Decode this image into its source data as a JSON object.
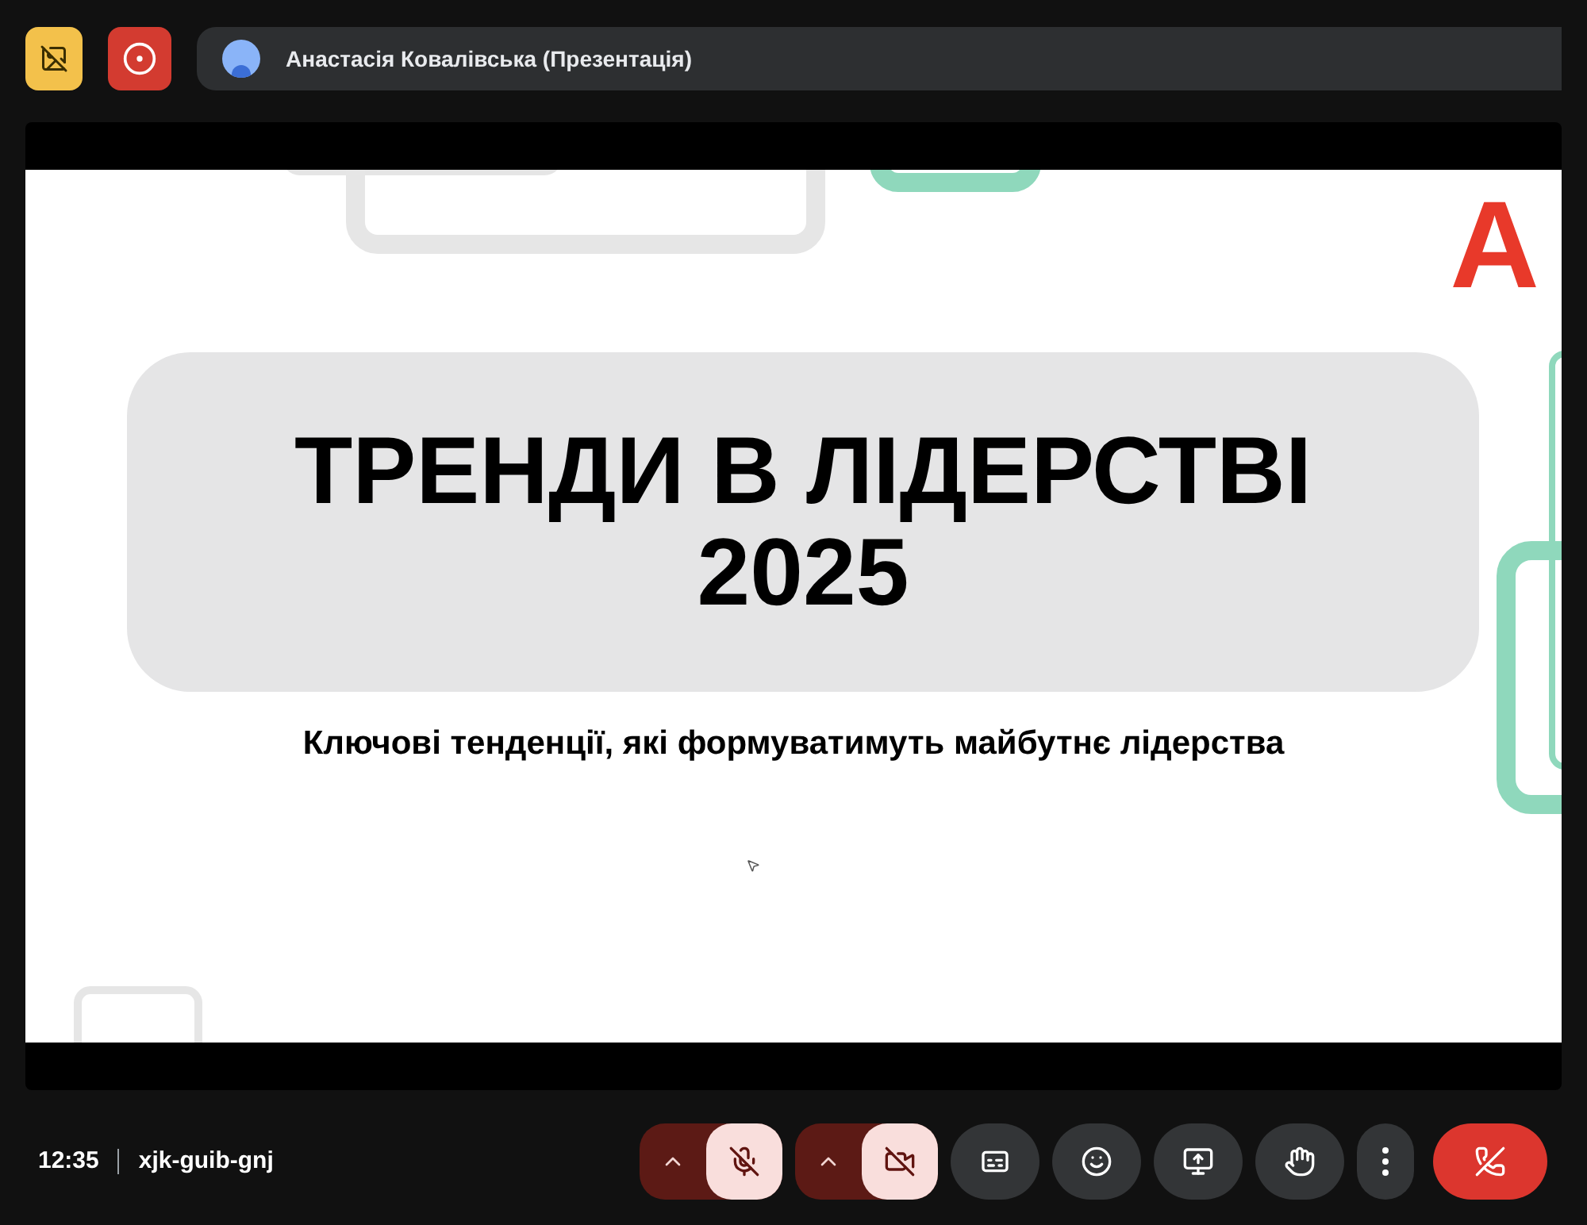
{
  "top_bar": {
    "presenter": "Анастасія Ковалівська (Презентація)"
  },
  "slide": {
    "logo_letter": "A",
    "title_lines": [
      "ТРЕНДИ В ЛІДЕРСТВІ",
      "2025"
    ],
    "subtitle": "Ключові тенденції, які формуватимуть майбутнє лідерства"
  },
  "meeting": {
    "time": "12:35",
    "code": "xjk-guib-gnj"
  },
  "controls": [
    {
      "kind": "microphone",
      "on": false
    },
    {
      "kind": "camera",
      "on": false
    },
    {
      "kind": "captions"
    },
    {
      "kind": "reactions"
    },
    {
      "kind": "present"
    },
    {
      "kind": "hand"
    },
    {
      "kind": "more"
    },
    {
      "kind": "leave"
    }
  ]
}
